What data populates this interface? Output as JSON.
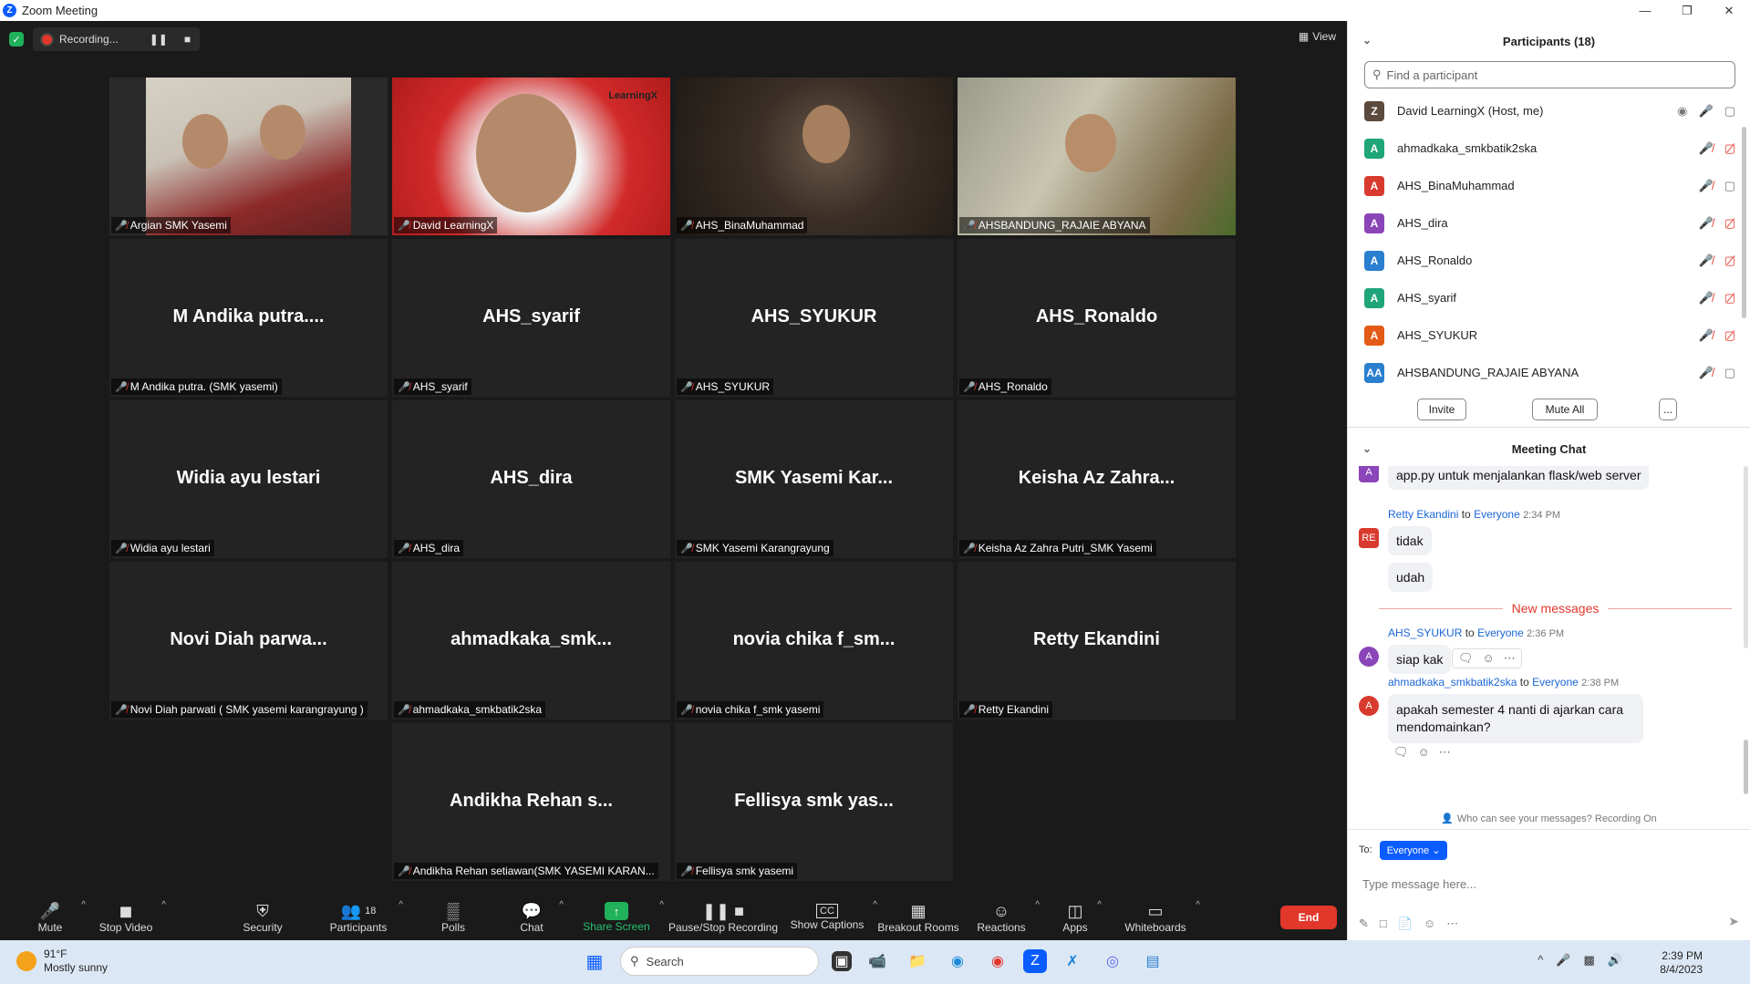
{
  "window": {
    "title": "Zoom Meeting"
  },
  "topbar": {
    "recording_label": "Recording...",
    "view_label": "View"
  },
  "tiles": [
    {
      "name": "Argian SMK Yasemi",
      "big": "",
      "video": "v1"
    },
    {
      "name": "David LearningX",
      "big": "",
      "video": "v2",
      "active": true
    },
    {
      "name": "AHS_BinaMuhammad",
      "big": "",
      "video": "v3"
    },
    {
      "name": "AHSBANDUNG_RAJAIE ABYANA",
      "big": "",
      "video": "v4"
    },
    {
      "name": "M Andika putra. (SMK yasemi)",
      "big": "M Andika putra...."
    },
    {
      "name": "AHS_syarif",
      "big": "AHS_syarif"
    },
    {
      "name": "AHS_SYUKUR",
      "big": "AHS_SYUKUR"
    },
    {
      "name": "AHS_Ronaldo",
      "big": "AHS_Ronaldo"
    },
    {
      "name": "Widia ayu lestari",
      "big": "Widia ayu lestari"
    },
    {
      "name": "AHS_dira",
      "big": "AHS_dira"
    },
    {
      "name": "SMK Yasemi Karangrayung",
      "big": "SMK Yasemi Kar..."
    },
    {
      "name": "Keisha Az Zahra Putri_SMK Yasemi",
      "big": "Keisha Az Zahra..."
    },
    {
      "name": "Novi Diah parwati ( SMK yasemi karangrayung )",
      "big": "Novi Diah parwa..."
    },
    {
      "name": "ahmadkaka_smkbatik2ska",
      "big": "ahmadkaka_smk..."
    },
    {
      "name": "novia chika f_smk yasemi",
      "big": "novia chika f_sm..."
    },
    {
      "name": "Retty Ekandini",
      "big": "Retty Ekandini"
    },
    {
      "name": "Andikha Rehan setiawan(SMK YASEMI KARAN...",
      "big": "Andikha Rehan s..."
    },
    {
      "name": "Fellisya smk yasemi",
      "big": "Fellisya smk yas..."
    }
  ],
  "logo_text": "LearningX",
  "toolbar": {
    "mute": "Mute",
    "stop_video": "Stop Video",
    "security": "Security",
    "participants": "Participants",
    "participants_count": "18",
    "polls": "Polls",
    "chat": "Chat",
    "share_screen": "Share Screen",
    "pause_recording": "Pause/Stop Recording",
    "captions": "Show Captions",
    "breakout": "Breakout Rooms",
    "reactions": "Reactions",
    "apps": "Apps",
    "whiteboards": "Whiteboards",
    "end": "End"
  },
  "participants_panel": {
    "title": "Participants (18)",
    "search_placeholder": "Find a participant",
    "items": [
      {
        "initial": "Z",
        "name": "David LearningX (Host, me)",
        "color": "#5b4a3d"
      },
      {
        "initial": "A",
        "name": "ahmadkaka_smkbatik2ska",
        "color": "#1fa57a"
      },
      {
        "initial": "A",
        "name": "AHS_BinaMuhammad",
        "color": "#d93a2e"
      },
      {
        "initial": "A",
        "name": "AHS_dira",
        "color": "#8a45b8"
      },
      {
        "initial": "A",
        "name": "AHS_Ronaldo",
        "color": "#2a7fcf"
      },
      {
        "initial": "A",
        "name": "AHS_syarif",
        "color": "#1fa57a"
      },
      {
        "initial": "A",
        "name": "AHS_SYUKUR",
        "color": "#e35b16"
      },
      {
        "initial": "AA",
        "name": "AHSBANDUNG_RAJAIE ABYANA",
        "color": "#2a7fcf"
      }
    ],
    "invite": "Invite",
    "mute_all": "Mute All",
    "more": "..."
  },
  "chat_panel": {
    "title": "Meeting Chat",
    "msg0": "app.py untuk menjalankan flask/web server",
    "msg1_sender": "Retty Ekandini",
    "msg1_to": "to",
    "msg1_target": "Everyone",
    "msg1_time": "2:34 PM",
    "msg1_avatar": "RE",
    "msg1_text_a": "tidak",
    "msg1_text_b": "udah",
    "new_messages": "New messages",
    "msg2_sender": "AHS_SYUKUR",
    "msg2_to": "to",
    "msg2_target": "Everyone",
    "msg2_time": "2:36 PM",
    "msg2_avatar": "A",
    "msg2_text": "siap kak",
    "msg3_sender": "ahmadkaka_smkbatik2ska",
    "msg3_to": "to",
    "msg3_target": "Everyone",
    "msg3_time": "2:38 PM",
    "msg3_avatar": "A",
    "msg3_text": "apakah semester 4 nanti di ajarkan cara mendomainkan?",
    "who_can_see": "Who can see your messages? Recording On",
    "to_label": "To:",
    "to_target": "Everyone",
    "input_placeholder": "Type message here..."
  },
  "taskbar": {
    "temp": "91°F",
    "weather": "Mostly sunny",
    "search": "Search",
    "time": "2:39 PM",
    "date": "8/4/2023"
  }
}
